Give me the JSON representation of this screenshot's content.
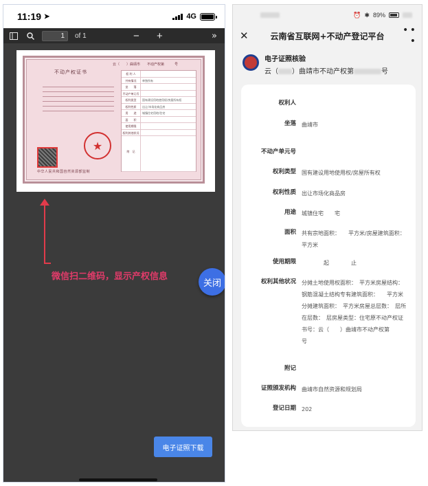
{
  "left_phone": {
    "status": {
      "time": "11:19",
      "network": "4G"
    },
    "pdf_toolbar": {
      "page_number": "1",
      "page_total": "of 1",
      "zoom_out": "−",
      "zoom_in": "+"
    },
    "certificate": {
      "title": "不动产权证书",
      "number_line": "云（　　）曲靖市　　不动产权第　　　号",
      "footer": "中华人民共和国自然资源部监制",
      "table_rows": [
        {
          "label": "权 利 人",
          "value": ""
        },
        {
          "label": "共有情况",
          "value": "单独所有"
        },
        {
          "label": "坐　　落",
          "value": ""
        },
        {
          "label": "不动产单元号",
          "value": ""
        },
        {
          "label": "权利类型",
          "value": "国有建设用地使用权/房屋所有权"
        },
        {
          "label": "权利性质",
          "value": "出让/市场化商品房"
        },
        {
          "label": "用　　途",
          "value": "城镇住宅用地/住宅"
        },
        {
          "label": "面　　积",
          "value": ""
        },
        {
          "label": "使用期限",
          "value": ""
        },
        {
          "label": "权利其他状况",
          "value": ""
        }
      ],
      "attachment_label": "附　记"
    },
    "annotation": "微信扫二维码，显示产权信息",
    "close_button": "关闭",
    "download_button": "电子证照下载"
  },
  "right_phone": {
    "status": {
      "battery": "89%"
    },
    "nav": {
      "title": "云南省互联网+不动产登记平台"
    },
    "verify": {
      "title": "电子证照核验",
      "subtitle_prefix": "云（",
      "subtitle_mid": "）曲靖市不动产权第",
      "subtitle_suffix": "号"
    },
    "fields": [
      {
        "label": "权利人",
        "value": ""
      },
      {
        "label": "坐落",
        "value": "曲靖市"
      },
      {
        "label": "不动产单元号",
        "value": ""
      },
      {
        "label": "权利类型",
        "value": "国有建设用地使用权/房屋所有权"
      },
      {
        "label": "权利性质",
        "value": "出让市场化商品房"
      },
      {
        "label": "用途",
        "value": "城镇住宅　　宅"
      },
      {
        "label": "面积",
        "value": "共有宗地面积：　　平方米/房屋建筑面积：　　平方米"
      },
      {
        "label": "使用期限",
        "value": "　　　　起　　　　止"
      },
      {
        "label": "权利其他状况",
        "value": "分摊土地使用权面积：　平方米房屋结构：钢筋混凝土结构专有建筑面积：　　平方米分摊建筑面积：　平方米房屋总层数：　层所在层数：　层房屋类型：住宅原不动产权证书号：云（　　）曲靖市不动产权第　　　号"
      },
      {
        "label": "附记",
        "value": ""
      },
      {
        "label": "证照颁发机构",
        "value": "曲靖市自然资源和规划局"
      },
      {
        "label": "登记日期",
        "value": "202"
      }
    ]
  }
}
